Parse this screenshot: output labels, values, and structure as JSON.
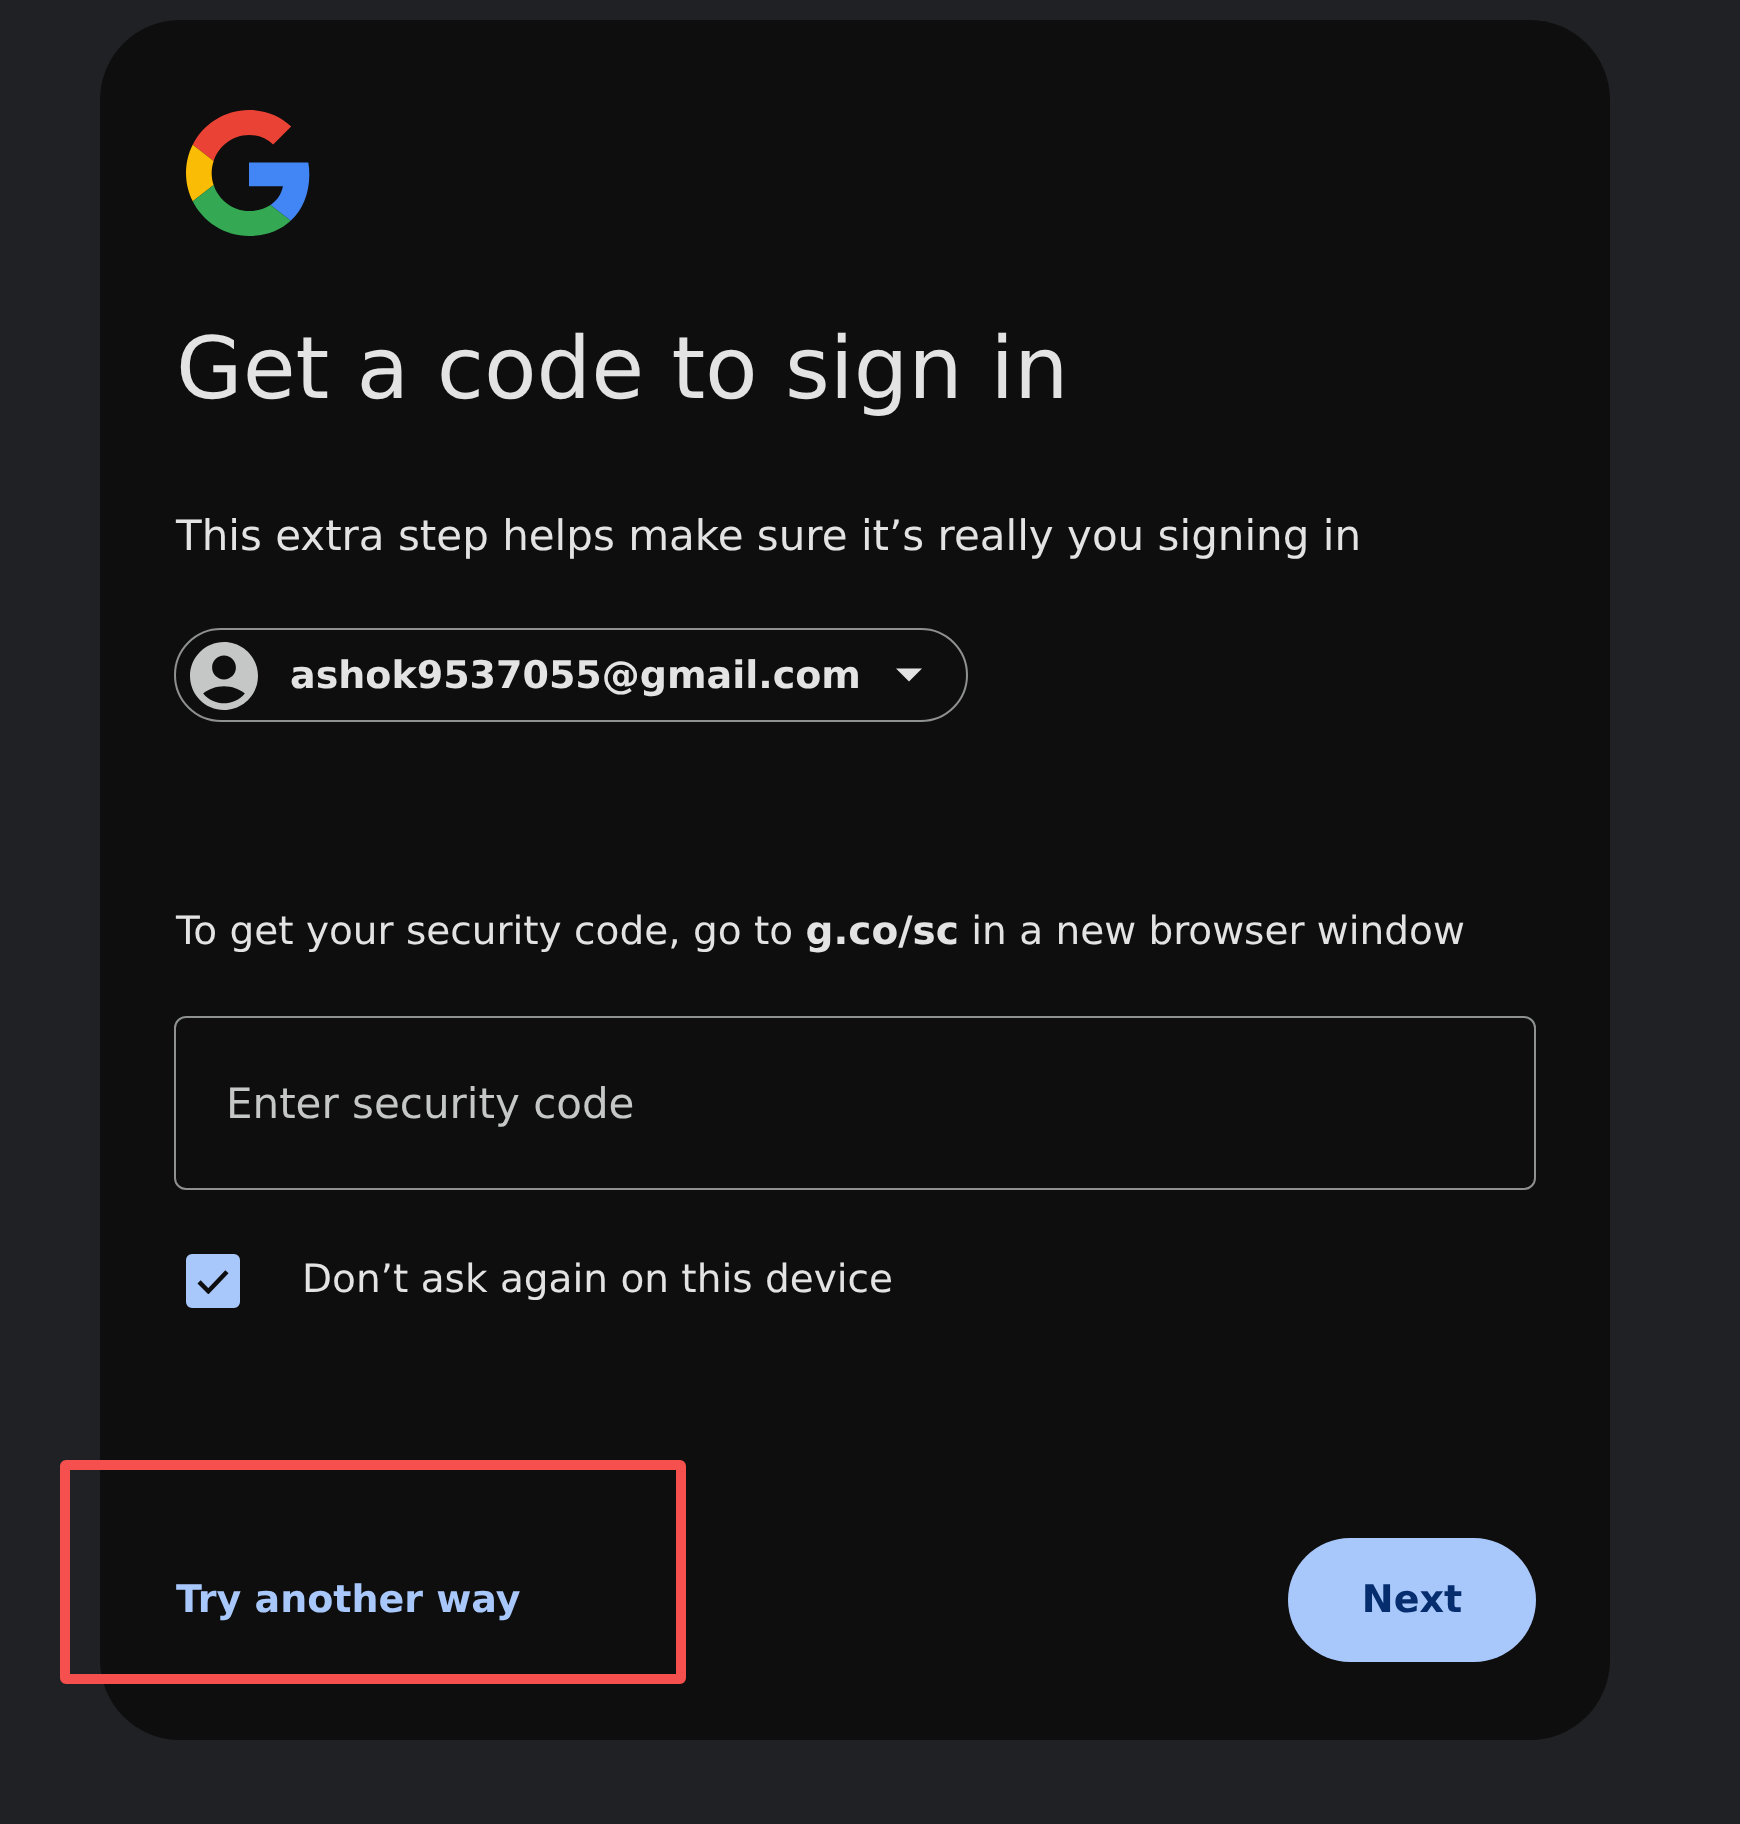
{
  "title": "Get a code to sign in",
  "subtitle": "This extra step helps make sure it’s really you signing in",
  "account": {
    "email": "ashok9537055@gmail.com"
  },
  "instruction": "To get your security code, go to **g.co/sc** in a new browser window",
  "code_field": {
    "placeholder": "Enter security code"
  },
  "remember_device": {
    "label": "Don’t ask again on this device",
    "checked": true
  },
  "try_another_way": {
    "label": "Try another way",
    "highlighted": true
  },
  "next_button": {
    "label": "Next"
  }
}
